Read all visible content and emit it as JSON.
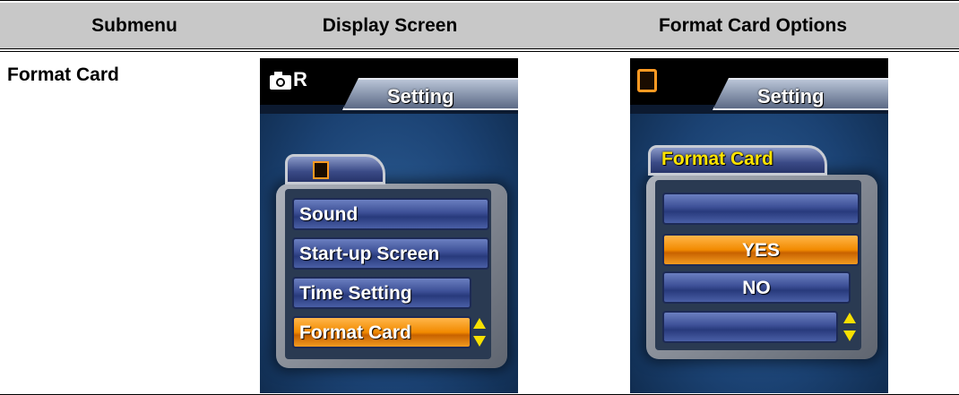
{
  "table": {
    "headers": [
      "Submenu",
      "Display Screen",
      "Format Card Options"
    ],
    "row_label": "Format Card"
  },
  "screen1": {
    "icons": [
      "camera-icon",
      "list-icon"
    ],
    "mode_letter": "R",
    "tab_title": "Setting",
    "menu_items": [
      {
        "label": "Sound",
        "selected": false
      },
      {
        "label": "Start-up Screen",
        "selected": false
      },
      {
        "label": "Time Setting",
        "selected": false
      },
      {
        "label": "Format Card",
        "selected": true
      }
    ]
  },
  "screen2": {
    "icons": [
      "list-icon"
    ],
    "tab_title": "Setting",
    "folder_title": "Format Card",
    "options": [
      {
        "label": "",
        "selected": false
      },
      {
        "label": "YES",
        "selected": true
      },
      {
        "label": "NO",
        "selected": false
      },
      {
        "label": "",
        "selected": false
      }
    ]
  },
  "colors": {
    "highlight": "#f28a00",
    "menu_item": "#3c4f96",
    "screen_bg": "#1b4273",
    "title_text": "#ffe400",
    "header_bg": "#c8c8c8"
  }
}
